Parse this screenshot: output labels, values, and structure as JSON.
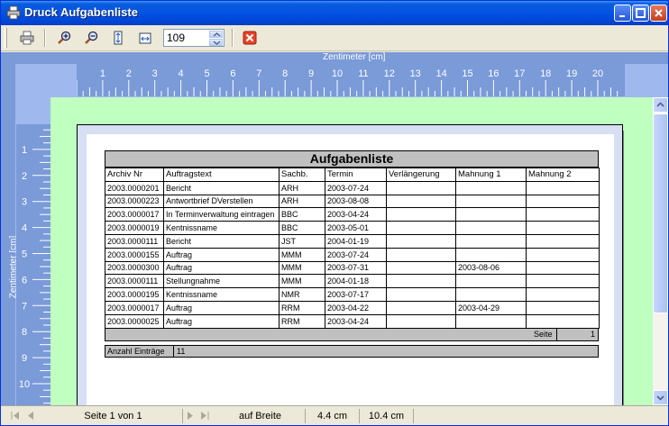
{
  "window": {
    "title": "Druck Aufgabenliste"
  },
  "toolbar": {
    "zoom_value": "109"
  },
  "rulers": {
    "horizontal_label": "Zentimeter [cm]",
    "vertical_label": "Zentimeter [cm]",
    "h_numbers": [
      "1",
      "2",
      "3",
      "4",
      "5",
      "6",
      "7",
      "8",
      "9",
      "10",
      "11",
      "12",
      "13",
      "14",
      "15",
      "16",
      "17",
      "18",
      "19",
      "20"
    ],
    "v_numbers": [
      "1",
      "2",
      "3",
      "4",
      "5",
      "6",
      "7",
      "8",
      "9",
      "10"
    ]
  },
  "report": {
    "title": "Aufgabenliste",
    "columns": [
      "Archiv Nr",
      "Auftragstext",
      "Sachb.",
      "Termin",
      "Verlängerung",
      "Mahnung 1",
      "Mahnung 2"
    ],
    "rows": [
      [
        "2003.0000201",
        "Bericht",
        "ARH",
        "2003-07-24",
        "",
        "",
        ""
      ],
      [
        "2003.0000223",
        "Antwortbrief DVerstellen",
        "ARH",
        "2003-08-08",
        "",
        "",
        ""
      ],
      [
        "2003.0000017",
        "In Terminverwaltung eintragen",
        "BBC",
        "2003-04-24",
        "",
        "",
        ""
      ],
      [
        "2003.0000019",
        "Kentnissname",
        "BBC",
        "2003-05-01",
        "",
        "",
        ""
      ],
      [
        "2003.0000111",
        "Bericht",
        "JST",
        "2004-01-19",
        "",
        "",
        ""
      ],
      [
        "2003.0000155",
        "Auftrag",
        "MMM",
        "2003-07-24",
        "",
        "",
        ""
      ],
      [
        "2003.0000300",
        "Auftrag",
        "MMM",
        "2003-07-31",
        "",
        "2003-08-06",
        ""
      ],
      [
        "2003.0000111",
        "Stellungnahme",
        "MMM",
        "2004-01-18",
        "",
        "",
        ""
      ],
      [
        "2003.0000195",
        "Kentnissname",
        "NMR",
        "2003-07-17",
        "",
        "",
        ""
      ],
      [
        "2003.0000017",
        "Auftrag",
        "RRM",
        "2003-04-22",
        "",
        "2003-04-29",
        ""
      ],
      [
        "2003.0000025",
        "Auftrag",
        "RRM",
        "2003-04-24",
        "",
        "",
        ""
      ]
    ],
    "page_label": "Seite",
    "page_value": "1",
    "count_label": "Anzahl Einträge",
    "count_value": "11"
  },
  "status": {
    "page_info": "Seite 1 von 1",
    "fit_mode": "auf Breite",
    "pos_x": "4.4 cm",
    "pos_y": "10.4 cm"
  }
}
